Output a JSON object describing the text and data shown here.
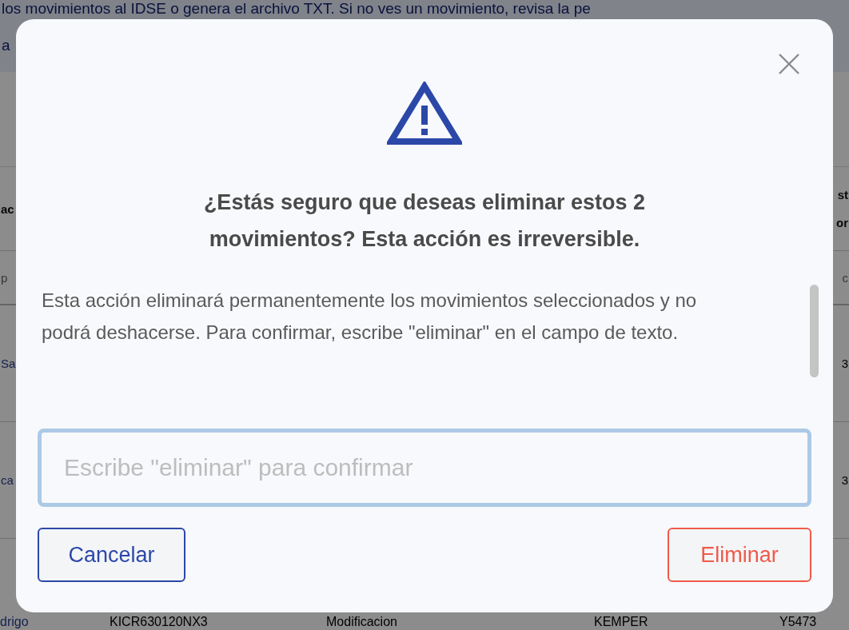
{
  "background": {
    "banner": [
      "los movimientos al IDSE o genera el archivo TXT. Si no ves un movimiento, revisa la pe",
      "a"
    ],
    "header": {
      "left": "ac",
      "right": [
        "st",
        "or"
      ]
    },
    "filter": {
      "left": "p",
      "right": "c"
    },
    "rows": [
      {
        "kind": "edge",
        "cells": [
          "Sa",
          "3"
        ]
      },
      {
        "kind": "edge",
        "cells": [
          "ca",
          "3"
        ]
      },
      {
        "kind": "full",
        "cells": [
          "drigo",
          "KICR630120NX3",
          "Modificacion",
          "KEMPER",
          "Y5473"
        ]
      }
    ]
  },
  "dialog": {
    "title": "¿Estás seguro que deseas eliminar estos 2 movimientos? Esta acción es irreversible.",
    "message": "Esta acción eliminará permanentemente los movimientos seleccionados y no podrá deshacerse. Para confirmar, escribe \"eliminar\" en el campo de texto.",
    "input": {
      "placeholder": "Escribe \"eliminar\" para confirmar"
    },
    "buttons": [
      {
        "kind": "secondary",
        "label": "Cancelar"
      },
      {
        "kind": "danger",
        "label": "Eliminar"
      }
    ]
  }
}
